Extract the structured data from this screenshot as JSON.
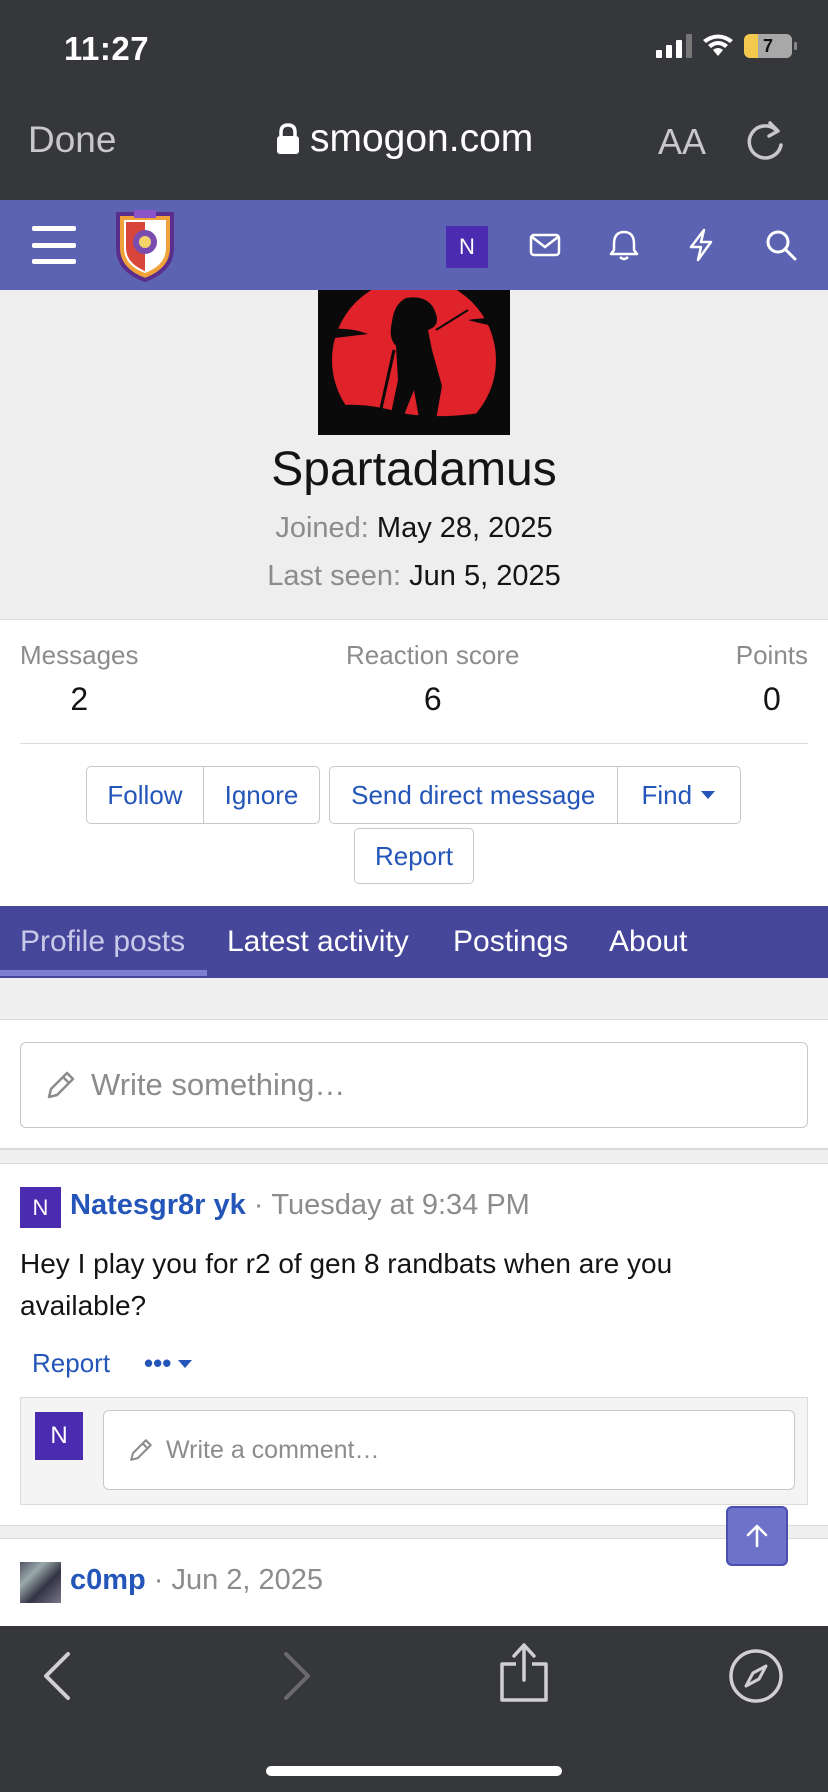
{
  "status_bar": {
    "time": "11:27",
    "battery": "7"
  },
  "browser": {
    "done_label": "Done",
    "url": "smogon.com",
    "text_size_label": "AA"
  },
  "header": {
    "user_initial": "N"
  },
  "profile": {
    "username": "Spartadamus",
    "joined_label": "Joined:",
    "joined_value": "May 28, 2025",
    "last_seen_label": "Last seen:",
    "last_seen_value": "Jun 5, 2025"
  },
  "stats": [
    {
      "label": "Messages",
      "value": "2"
    },
    {
      "label": "Reaction score",
      "value": "6"
    },
    {
      "label": "Points",
      "value": "0"
    }
  ],
  "actions": {
    "follow": "Follow",
    "ignore": "Ignore",
    "send_dm": "Send direct message",
    "find": "Find",
    "report": "Report"
  },
  "tabs": [
    "Profile posts",
    "Latest activity",
    "Postings",
    "About"
  ],
  "composer": {
    "placeholder": "Write something…"
  },
  "posts": [
    {
      "author_initial": "N",
      "author": "Natesgr8r yk",
      "separator": "·",
      "time": "Tuesday at 9:34 PM",
      "body": "Hey I play you for r2 of gen 8 randbats when are you available?",
      "report_label": "Report",
      "more_label": "•••",
      "comment_initial": "N",
      "comment_placeholder": "Write a comment…"
    },
    {
      "author": "c0mp",
      "separator": "·",
      "time": "Jun 2, 2025"
    }
  ],
  "colors": {
    "header_bg": "#5c63b3",
    "tabs_bg": "#46469b",
    "link": "#2455b8",
    "avatar_bg": "#4b2bb0",
    "browser_chrome": "#36373b"
  }
}
